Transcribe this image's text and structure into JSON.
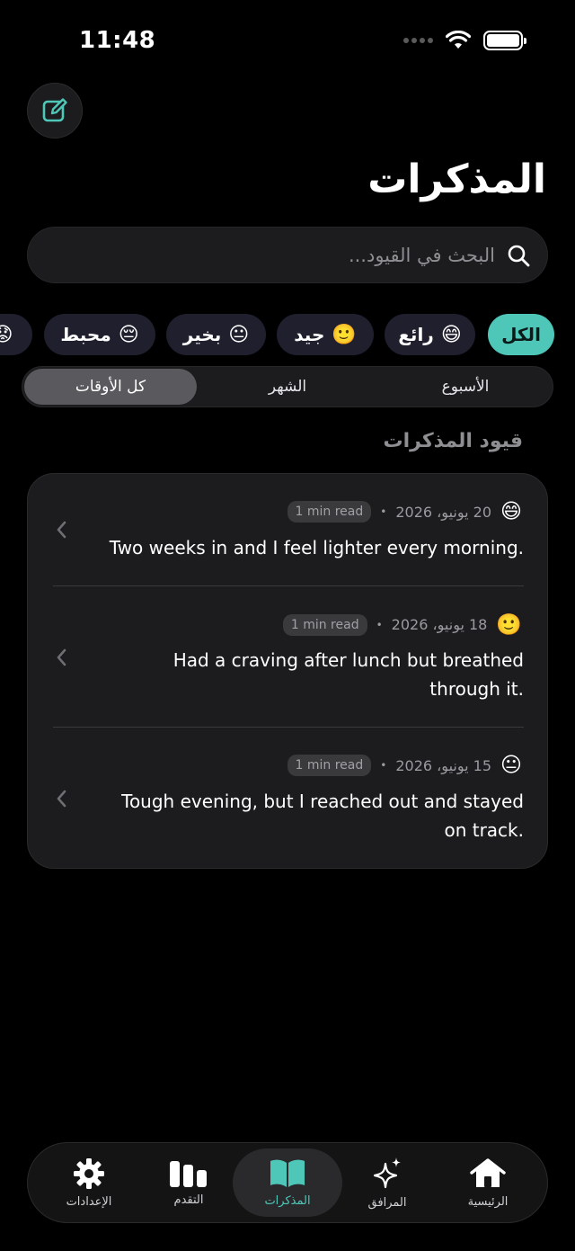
{
  "status_bar": {
    "time": "11:48"
  },
  "header": {
    "title": "المذكرات"
  },
  "search": {
    "placeholder": "البحث في القيود..."
  },
  "mood_filters": [
    {
      "label": "الكل",
      "emoji": ""
    },
    {
      "label": "رائع",
      "emoji": "😄"
    },
    {
      "label": "جيد",
      "emoji": "🙂"
    },
    {
      "label": "بخير",
      "emoji": "😐"
    },
    {
      "label": "محبط",
      "emoji": "😔"
    },
    {
      "label": "",
      "emoji": "😟"
    }
  ],
  "time_range": {
    "options": [
      "الأسبوع",
      "الشهر",
      "كل الأوقات"
    ],
    "selected": "كل الأوقات"
  },
  "section": {
    "title": "قيود المذكرات"
  },
  "entries": [
    {
      "emoji": "😄",
      "date": "20 يونيو، 2026",
      "read_time": "1 min read",
      "text": "Two weeks in and I feel lighter every morning."
    },
    {
      "emoji": "🙂",
      "date": "18 يونيو، 2026",
      "read_time": "1 min read",
      "text": "Had a craving after lunch but breathed through it."
    },
    {
      "emoji": "😐",
      "date": "15 يونيو، 2026",
      "read_time": "1 min read",
      "text": "Tough evening, but I reached out and stayed on track."
    }
  ],
  "tab_bar": {
    "tabs": [
      {
        "label": "الإعدادات",
        "icon": "gear-icon"
      },
      {
        "label": "التقدم",
        "icon": "bar-chart-icon"
      },
      {
        "label": "المذكرات",
        "icon": "book-icon"
      },
      {
        "label": "المرافق",
        "icon": "sparkles-icon"
      },
      {
        "label": "الرئيسية",
        "icon": "home-icon"
      }
    ],
    "active": "المذكرات"
  },
  "colors": {
    "accent": "#4ec7b8",
    "background": "#000000",
    "card": "#1c1c1e"
  }
}
